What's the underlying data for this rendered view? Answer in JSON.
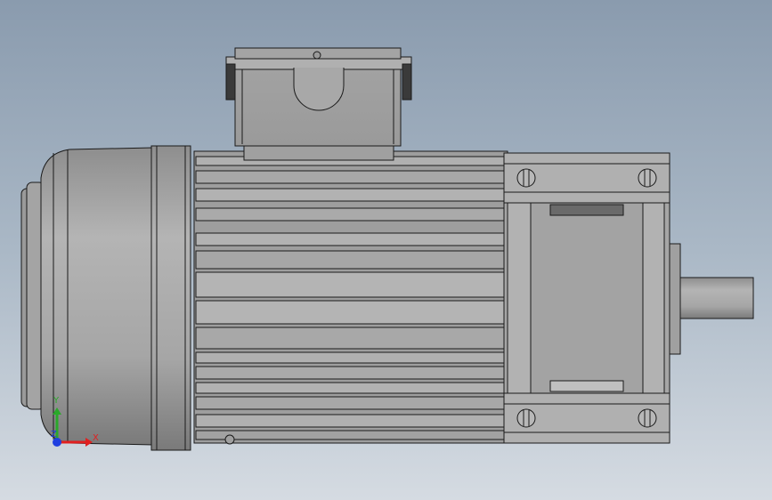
{
  "viewport": {
    "background_top": "#8a9bae",
    "background_bottom": "#d5dbe2",
    "model_fill": "#a7a7a7",
    "model_edge": "#1a1a1a"
  },
  "axis_triad": {
    "x_label": "X",
    "y_label": "Y",
    "z_label": "Z",
    "x_color": "#e02020",
    "y_color": "#2aa82a",
    "z_color": "#2040e0"
  }
}
